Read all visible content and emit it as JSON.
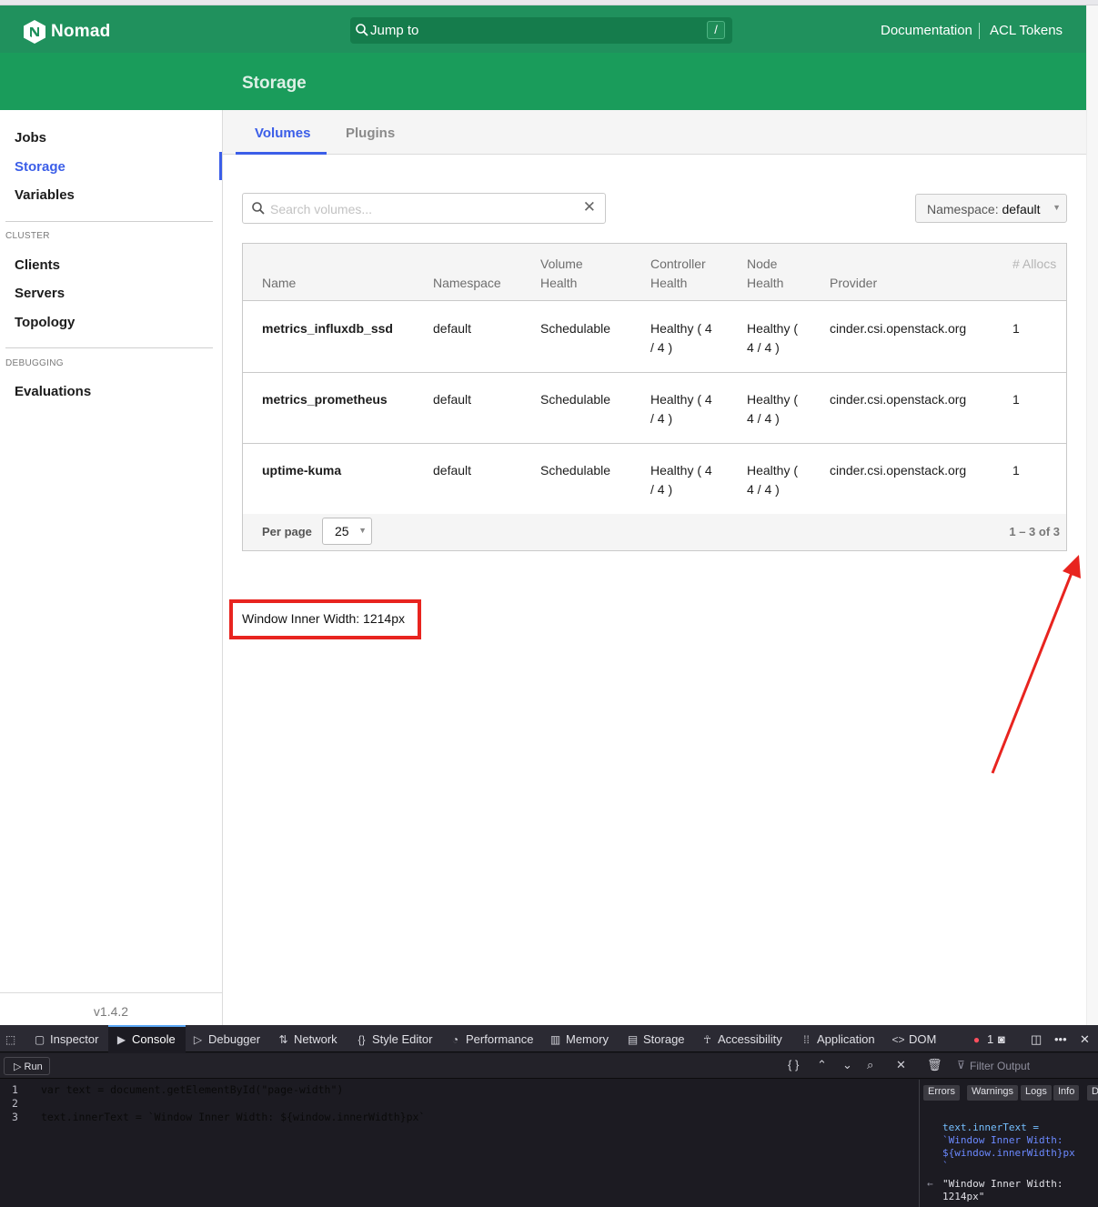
{
  "app": {
    "name": "Nomad",
    "section_title": "Storage",
    "version": "v1.4.2"
  },
  "header": {
    "search_label": "Jump to",
    "search_shortcut": "/",
    "links": [
      "Documentation",
      "ACL Tokens"
    ]
  },
  "sidebar": {
    "items": [
      {
        "label": "Jobs"
      },
      {
        "label": "Storage",
        "active": true
      },
      {
        "label": "Variables"
      }
    ],
    "sections": [
      {
        "title": "CLUSTER",
        "items": [
          "Clients",
          "Servers",
          "Topology"
        ]
      },
      {
        "title": "DEBUGGING",
        "items": [
          "Evaluations"
        ]
      }
    ]
  },
  "tabs": [
    {
      "label": "Volumes",
      "active": true
    },
    {
      "label": "Plugins",
      "active": false
    }
  ],
  "filters": {
    "search_placeholder": "Search volumes...",
    "namespace_label": "Namespace:",
    "namespace_value": "default"
  },
  "table": {
    "headers": {
      "name": "Name",
      "namespace": "Namespace",
      "volume_health": "Volume Health",
      "controller_health": "Controller Health",
      "node_health": "Node Health",
      "provider": "Provider",
      "allocs": "# Allocs"
    },
    "rows": [
      {
        "name": "metrics_influxdb_ssd",
        "namespace": "default",
        "volume_health": "Schedulable",
        "controller_health": "Healthy ( 4 / 4 )",
        "node_health": "Healthy ( 4 / 4 )",
        "provider": "cinder.csi.openstack.org",
        "allocs": "1"
      },
      {
        "name": "metrics_prometheus",
        "namespace": "default",
        "volume_health": "Schedulable",
        "controller_health": "Healthy ( 4 / 4 )",
        "node_health": "Healthy ( 4 / 4 )",
        "provider": "cinder.csi.openstack.org",
        "allocs": "1"
      },
      {
        "name": "uptime-kuma",
        "namespace": "default",
        "volume_health": "Schedulable",
        "controller_health": "Healthy ( 4 / 4 )",
        "node_health": "Healthy ( 4 / 4 )",
        "provider": "cinder.csi.openstack.org",
        "allocs": "1"
      }
    ],
    "footer": {
      "per_page_label": "Per page",
      "per_page_value": "25",
      "range": "1 – 3 of 3"
    }
  },
  "width_readout": "Window Inner Width: 1214px",
  "devtools": {
    "tabs": [
      "Inspector",
      "Console",
      "Debugger",
      "Network",
      "Style Editor",
      "Performance",
      "Memory",
      "Storage",
      "Accessibility",
      "Application",
      "DOM"
    ],
    "active_tab": "Console",
    "error_count": "1",
    "run_label": "Run",
    "filter_placeholder": "Filter Output",
    "filter_buttons": [
      "Errors",
      "Warnings",
      "Logs",
      "Info",
      "D"
    ],
    "code_lines": [
      "var text = document.getElementById(\"page-width\")",
      "",
      "text.innerText = `Window Inner Width: ${window.innerWidth}px`"
    ],
    "output_echo": [
      "text.innerText =",
      "`Window Inner Width:",
      "${window.innerWidth}px",
      "`"
    ],
    "output_result": [
      "\"Window Inner Width:",
      "1214px\""
    ]
  },
  "colors": {
    "brand": "#1a9c5b",
    "accent": "#3b5ee8",
    "annotation": "#e8241f"
  }
}
